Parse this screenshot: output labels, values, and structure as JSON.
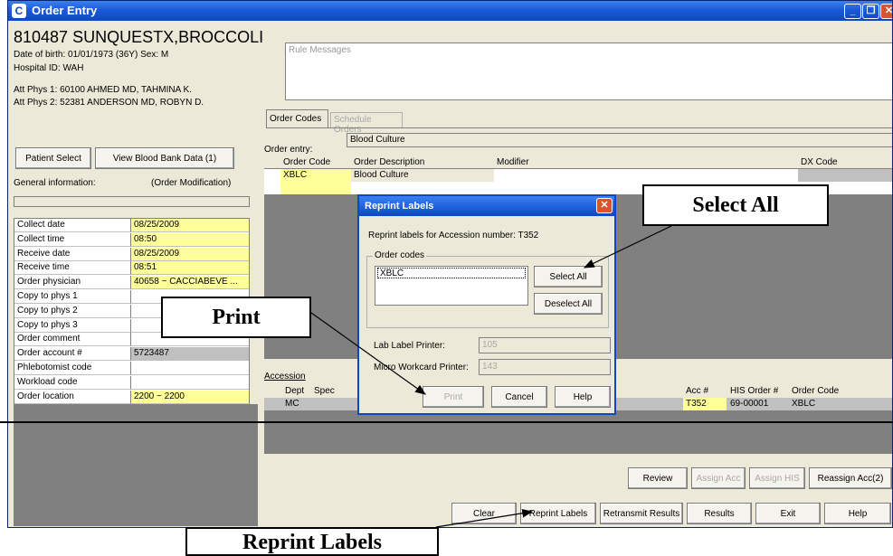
{
  "window": {
    "title": "Order Entry",
    "icon": "C",
    "controls": [
      "_",
      "❐",
      "✕"
    ]
  },
  "patient": {
    "header": "810487 SUNQUESTX,BROCCOLI",
    "dob_line": "Date of birth: 01/01/1973 (36Y)    Sex: M",
    "hospital": "Hospital ID: WAH",
    "phys1": "Att Phys 1: 60100 AHMED MD, TAHMINA K.",
    "phys2": "Att Phys 2: 52381 ANDERSON MD, ROBYN D."
  },
  "left_buttons": {
    "patient_select": "Patient Select",
    "view_blood_bank": "View Blood Bank Data (1)"
  },
  "general_info": {
    "label": "General information:",
    "mode": "(Order Modification)"
  },
  "info_rows": [
    {
      "label": "Collect date",
      "value": "08/25/2009",
      "bg": "#ffff99"
    },
    {
      "label": "Collect time",
      "value": "08:50",
      "bg": "#ffff99"
    },
    {
      "label": "Receive date",
      "value": "08/25/2009",
      "bg": "#ffff99"
    },
    {
      "label": "Receive time",
      "value": "08:51",
      "bg": "#ffff99"
    },
    {
      "label": "Order physician",
      "value": "40658 ~ CACCIABEVE ...",
      "bg": "#ffff99"
    },
    {
      "label": "Copy to phys 1",
      "value": "",
      "bg": "#ffffff"
    },
    {
      "label": "Copy to phys 2",
      "value": "",
      "bg": "#ffffff"
    },
    {
      "label": "Copy to phys 3",
      "value": "",
      "bg": "#ffffff"
    },
    {
      "label": "Order comment",
      "value": "",
      "bg": "#ffffff"
    },
    {
      "label": "Order account #",
      "value": "5723487",
      "bg": "#c0c0c0"
    },
    {
      "label": "Phlebotomist code",
      "value": "",
      "bg": "#ffffff"
    },
    {
      "label": "Workload code",
      "value": "",
      "bg": "#ffffff"
    },
    {
      "label": "Order location",
      "value": "2200 ~ 2200",
      "bg": "#ffff99"
    }
  ],
  "rule_messages": "Rule Messages",
  "tabs": {
    "order_codes": "Order Codes",
    "schedule_orders": "Schedule Orders"
  },
  "order_entry": {
    "label": "Order entry:",
    "value": "Blood Culture"
  },
  "order_table": {
    "headers": [
      "Order Code",
      "Order Description",
      "Modifier",
      "DX Code"
    ],
    "row": {
      "code": "XBLC",
      "description": "Blood Culture"
    }
  },
  "accession": {
    "label": "Accession",
    "headers": [
      "Dept",
      "Spec",
      "Acc #",
      "HIS Order #",
      "Order Code"
    ],
    "row": {
      "dept": "MC",
      "acc": "T352",
      "his": "69-00001",
      "code": "XBLC"
    }
  },
  "mid_buttons": {
    "review": "Review",
    "assign_acc": "Assign Acc",
    "assign_his": "Assign HIS",
    "reassign_acc": "Reassign Acc(2)"
  },
  "bottom_buttons": {
    "clear": "Clear",
    "reprint_labels": "Reprint Labels",
    "retransmit": "Retransmit Results",
    "results": "Results",
    "exit": "Exit",
    "help": "Help"
  },
  "dialog": {
    "title": "Reprint Labels",
    "message": "Reprint labels for Accession number: T352",
    "order_codes_label": "Order codes",
    "order_codes_item": "XBLC",
    "select_all": "Select All",
    "deselect_all": "Deselect All",
    "lab_printer_label": "Lab Label Printer:",
    "lab_printer_value": "105",
    "micro_printer_label": "Micro Workcard Printer:",
    "micro_printer_value": "143",
    "print": "Print",
    "cancel": "Cancel",
    "help": "Help"
  },
  "callouts": {
    "select_all": "Select All",
    "print": "Print",
    "reprint_labels": "Reprint Labels"
  }
}
